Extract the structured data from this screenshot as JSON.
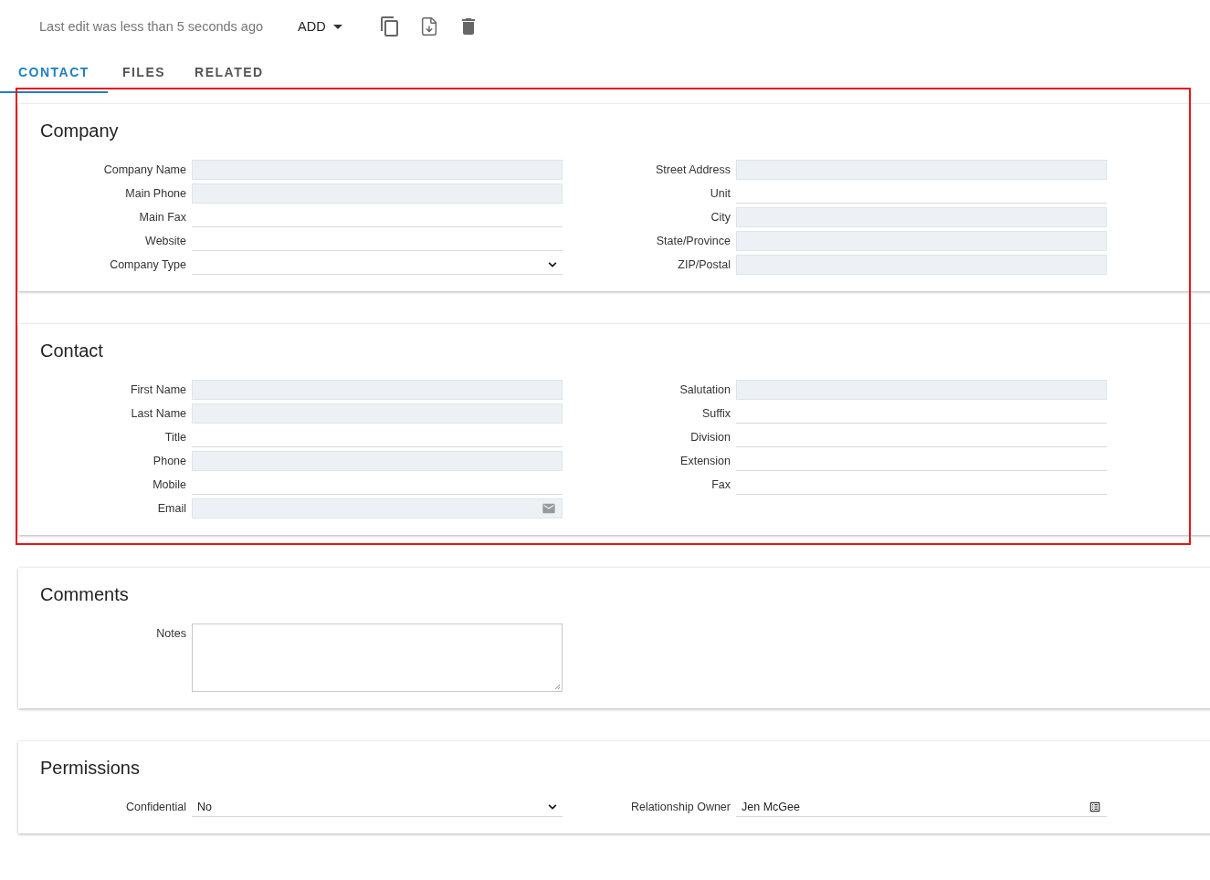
{
  "toolbar": {
    "status": "Last edit was less than 5 seconds ago",
    "add_button": "ADD"
  },
  "tabs": [
    {
      "label": "CONTACT",
      "selected": true
    },
    {
      "label": "FILES",
      "selected": false
    },
    {
      "label": "RELATED",
      "selected": false
    }
  ],
  "sections": [
    {
      "title": "Company",
      "columns": [
        [
          {
            "label": "Company Name",
            "kind": "shaded"
          },
          {
            "label": "Main Phone",
            "kind": "shaded"
          },
          {
            "label": "Main Fax",
            "kind": "line"
          },
          {
            "label": "Website",
            "kind": "line"
          },
          {
            "label": "Company Type",
            "kind": "select"
          }
        ],
        [
          {
            "label": "Street Address",
            "kind": "shaded"
          },
          {
            "label": "Unit",
            "kind": "line"
          },
          {
            "label": "City",
            "kind": "shaded"
          },
          {
            "label": "State/Province",
            "kind": "shaded"
          },
          {
            "label": "ZIP/Postal",
            "kind": "shaded"
          }
        ]
      ]
    },
    {
      "title": "Contact",
      "columns": [
        [
          {
            "label": "First Name",
            "kind": "shaded"
          },
          {
            "label": "Last Name",
            "kind": "shaded"
          },
          {
            "label": "Title",
            "kind": "line"
          },
          {
            "label": "Phone",
            "kind": "shaded"
          },
          {
            "label": "Mobile",
            "kind": "line"
          },
          {
            "label": "Email",
            "kind": "email"
          }
        ],
        [
          {
            "label": "Salutation",
            "kind": "shaded"
          },
          {
            "label": "Suffix",
            "kind": "line"
          },
          {
            "label": "Division",
            "kind": "line"
          },
          {
            "label": "Extension",
            "kind": "line"
          },
          {
            "label": "Fax",
            "kind": "line"
          }
        ]
      ]
    },
    {
      "title": "Comments",
      "columns": [
        [
          {
            "label": "Notes",
            "kind": "textarea"
          }
        ]
      ]
    },
    {
      "title": "Permissions",
      "columns": [
        [
          {
            "label": "Confidential",
            "kind": "select",
            "value": "No"
          }
        ],
        [
          {
            "label": "Relationship Owner",
            "kind": "lookup",
            "value": "Jen McGee"
          }
        ]
      ]
    }
  ]
}
